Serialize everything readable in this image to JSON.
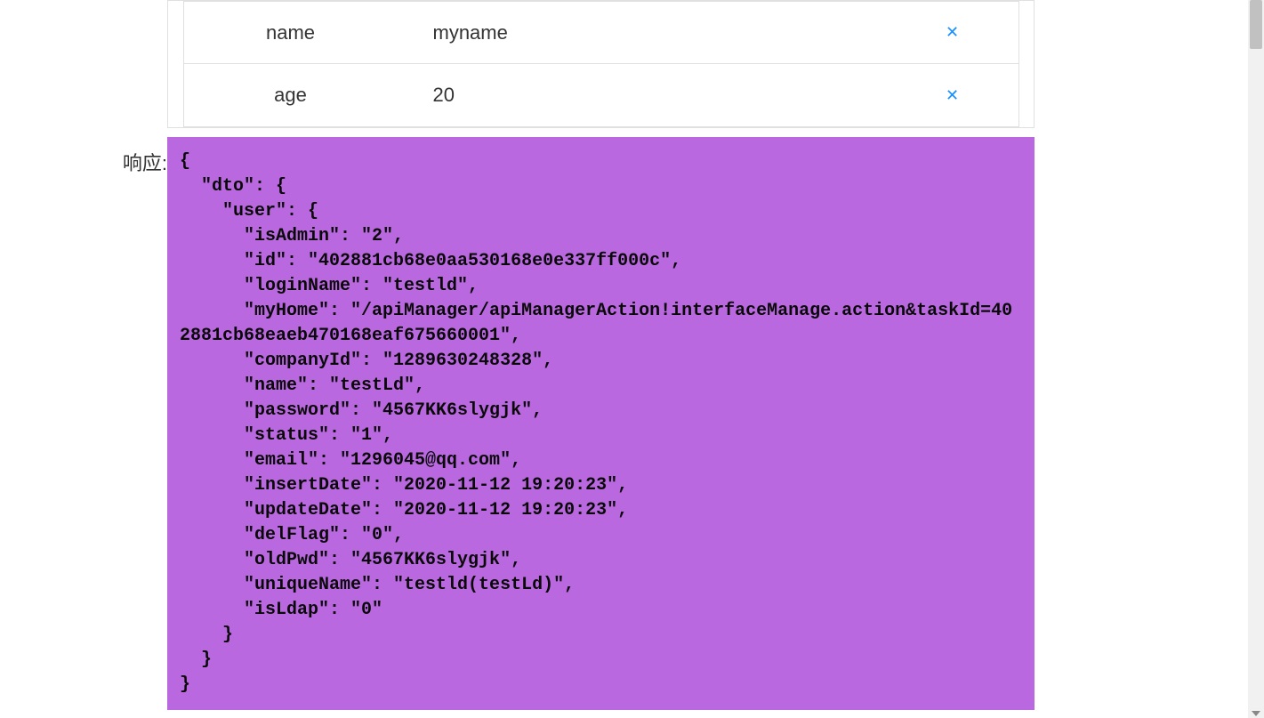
{
  "params": {
    "rows": [
      {
        "key": "name",
        "value": "myname"
      },
      {
        "key": "age",
        "value": "20"
      }
    ]
  },
  "response": {
    "label": "响应:",
    "json_text": "{\n  \"dto\": {\n    \"user\": {\n      \"isAdmin\": \"2\",\n      \"id\": \"402881cb68e0aa530168e0e337ff000c\",\n      \"loginName\": \"testld\",\n      \"myHome\": \"/apiManager/apiManagerAction!interfaceManage.action&taskId=402881cb68eaeb470168eaf675660001\",\n      \"companyId\": \"1289630248328\",\n      \"name\": \"testLd\",\n      \"password\": \"4567KK6slygjk\",\n      \"status\": \"1\",\n      \"email\": \"1296045@qq.com\",\n      \"insertDate\": \"2020-11-12 19:20:23\",\n      \"updateDate\": \"2020-11-12 19:20:23\",\n      \"delFlag\": \"0\",\n      \"oldPwd\": \"4567KK6slygjk\",\n      \"uniqueName\": \"testld(testLd)\",\n      \"isLdap\": \"0\"\n    }\n  }\n}"
  }
}
